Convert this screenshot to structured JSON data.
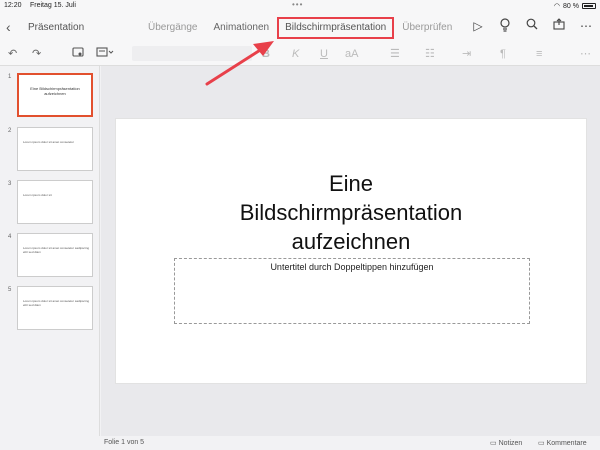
{
  "status": {
    "time": "12:20",
    "date": "Freitag 15. Juli",
    "dots": "•••",
    "battery": "80 %"
  },
  "header": {
    "back": "‹",
    "title": "Präsentation",
    "tabs": [
      {
        "label": "Übergänge"
      },
      {
        "label": "Animationen"
      },
      {
        "label": "Bildschirmpräsentation"
      },
      {
        "label": "Überprüfen"
      }
    ]
  },
  "toolbar": {
    "bold": "B",
    "italic": "K",
    "underline": "U",
    "font_size": "aA"
  },
  "slides": [
    {
      "number": "1",
      "title": "Eine Bildschirmpräsentation aufzeichnen"
    },
    {
      "number": "2",
      "text": "Lorem ipsum dolor sit amet consetetur"
    },
    {
      "number": "3",
      "text": "Lorem ipsum dolor sit"
    },
    {
      "number": "4",
      "text": "Lorem ipsum dolor sit amet consetetur sadipscing elitr sed diam"
    },
    {
      "number": "5",
      "text": "Lorem ipsum dolor sit amet consetetur sadipscing elitr sed diam"
    }
  ],
  "current_slide": {
    "title_lines": [
      "Eine",
      "Bildschirmpräsentation",
      "aufzeichnen"
    ],
    "subtitle": "Untertitel durch Doppeltippen hinzufügen"
  },
  "footer": {
    "slide_count": "Folie 1 von 5",
    "notes": "Notizen",
    "comments": "Kommentare"
  },
  "colors": {
    "highlight": "#e8404a",
    "selected_thumb": "#e2502e"
  }
}
